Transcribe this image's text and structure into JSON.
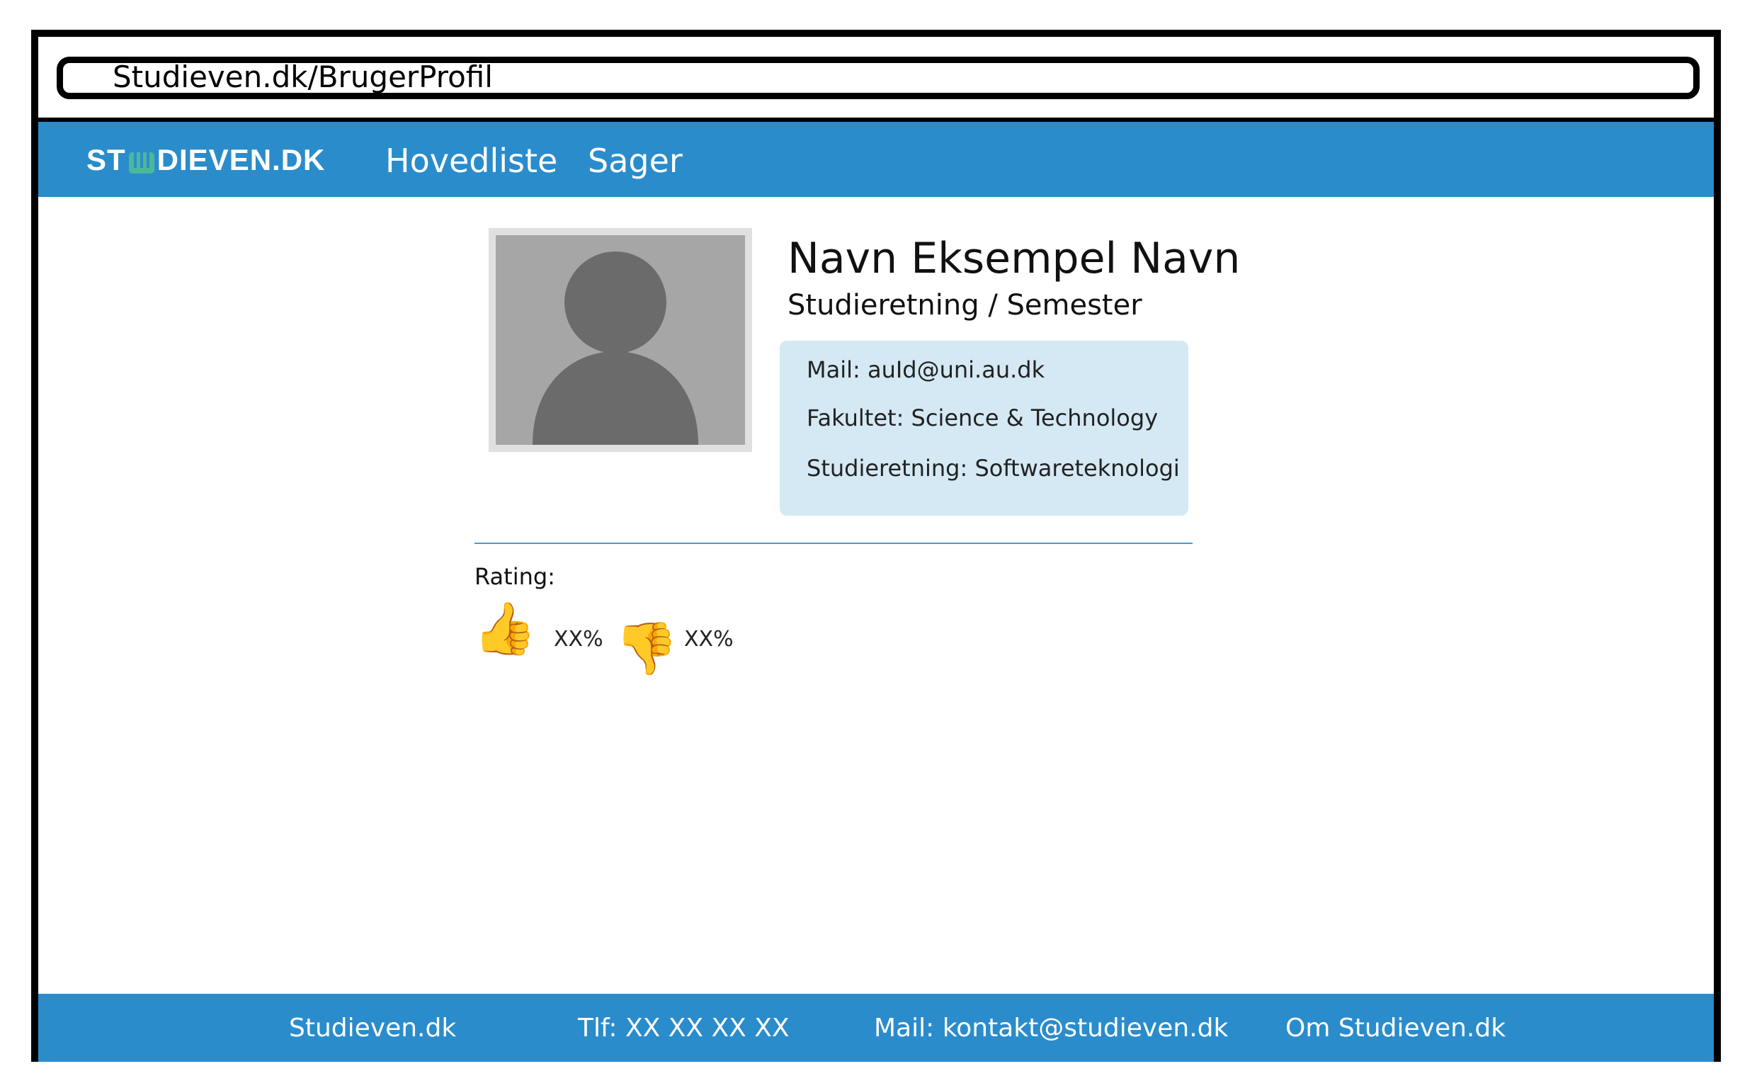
{
  "browser": {
    "url": "Studieven.dk/BrugerProfil"
  },
  "navbar": {
    "logo_left": "ST",
    "logo_right": "DIEVEN.DK",
    "links": [
      {
        "label": "Hovedliste"
      },
      {
        "label": "Sager"
      }
    ]
  },
  "profile": {
    "name": "Navn Eksempel Navn",
    "subtitle": "Studieretning / Semester",
    "info": {
      "mail": "Mail: auId@uni.au.dk",
      "fakultet": "Fakultet: Science & Technology",
      "studieretning": "Studieretning: Softwareteknologi"
    }
  },
  "rating": {
    "label": "Rating:",
    "thumbs_up_icon": "thumbs-up-icon",
    "thumbs_up_pct": "XX%",
    "thumbs_down_icon": "thumbs-down-icon",
    "thumbs_down_pct": "XX%"
  },
  "footer": {
    "links": [
      {
        "label": "Studieven.dk"
      },
      {
        "label": "Tlf: XX XX XX XX"
      },
      {
        "label": "Mail: kontakt@studieven.dk"
      },
      {
        "label": "Om Studieven.dk"
      }
    ]
  },
  "colors": {
    "brand_blue": "#2a8ccb",
    "info_box": "#d4e9f4",
    "logo_book": "#4bb89a"
  }
}
